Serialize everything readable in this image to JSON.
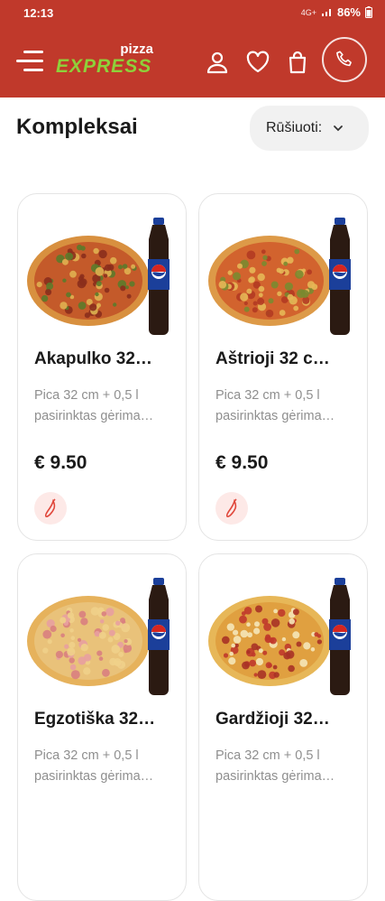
{
  "status": {
    "time": "12:13",
    "battery": "86%",
    "network": "4G+"
  },
  "header": {
    "logo_top": "pizza",
    "logo_main": "EXPRESS"
  },
  "page": {
    "title": "Kompleksai",
    "sort_label": "Rūšiuoti:"
  },
  "products": [
    {
      "name": "Akapulko 32…",
      "desc": "Pica 32 cm + 0,5 l pasirinktas gėrima…",
      "price": "€ 9.50",
      "pizza": "mixed"
    },
    {
      "name": "Aštrioji 32 c…",
      "desc": "Pica 32 cm + 0,5 l pasirinktas gėrima…",
      "price": "€ 9.50",
      "pizza": "pepperoni"
    },
    {
      "name": "Egzotiška 32…",
      "desc": "Pica 32 cm + 0,5 l pasirinktas gėrima…",
      "price": "",
      "pizza": "ham"
    },
    {
      "name": "Gardžioji 32…",
      "desc": "Pica 32 cm + 0,5 l pasirinktas gėrima…",
      "price": "",
      "pizza": "onion"
    }
  ],
  "colors": {
    "brand_red": "#c0392b",
    "logo_green": "#8ed13a",
    "pepsi_blue": "#1b3f9a"
  }
}
